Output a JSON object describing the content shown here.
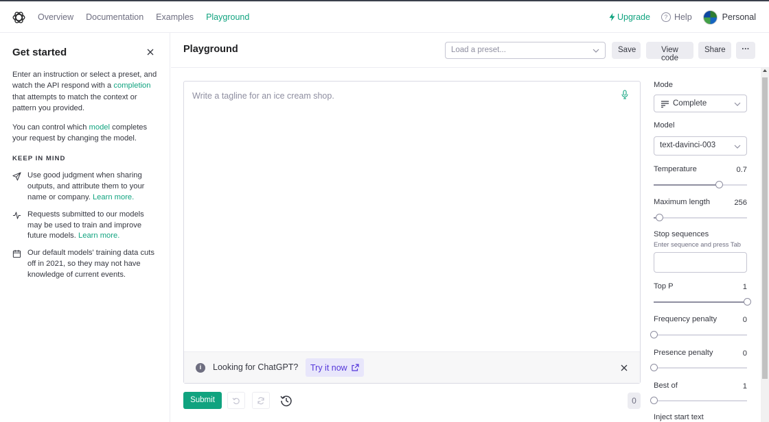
{
  "nav": {
    "links": [
      "Overview",
      "Documentation",
      "Examples",
      "Playground"
    ],
    "active": "Playground",
    "upgrade": "Upgrade",
    "help": "Help",
    "account": "Personal"
  },
  "sidebar": {
    "title": "Get started",
    "intro_before": "Enter an instruction or select a preset, and watch the API respond with a ",
    "intro_link": "completion",
    "intro_after": " that attempts to match the context or pattern you provided.",
    "control_before": "You can control which ",
    "control_link": "model",
    "control_after": " completes your request by changing the model.",
    "keep_heading": "KEEP IN MIND",
    "tips": [
      {
        "icon": "send-icon",
        "text": "Use good judgment when sharing outputs, and attribute them to your name or company.",
        "link": "Learn more."
      },
      {
        "icon": "activity-icon",
        "text": "Requests submitted to our models may be used to train and improve future models.",
        "link": "Learn more."
      },
      {
        "icon": "calendar-icon",
        "text": "Our default models' training data cuts off in 2021, so they may not have knowledge of current events.",
        "link": ""
      }
    ]
  },
  "header": {
    "title": "Playground",
    "preset_placeholder": "Load a preset...",
    "save": "Save",
    "view_code": "View code",
    "share": "Share",
    "more": "···"
  },
  "editor": {
    "placeholder": "Write a tagline for an ice cream shop.",
    "chat_prompt": "Looking for ChatGPT?",
    "try_it": "Try it now"
  },
  "footer": {
    "submit": "Submit",
    "token_count": "0"
  },
  "settings": {
    "mode_label": "Mode",
    "mode_value": "Complete",
    "model_label": "Model",
    "model_value": "text-davinci-003",
    "temperature_label": "Temperature",
    "temperature_value": "0.7",
    "temperature_fraction": 0.7,
    "max_length_label": "Maximum length",
    "max_length_value": "256",
    "max_length_fraction": 0.06,
    "stop_label": "Stop sequences",
    "stop_hint": "Enter sequence and press Tab",
    "top_p_label": "Top P",
    "top_p_value": "1",
    "top_p_fraction": 1.0,
    "frequency_label": "Frequency penalty",
    "frequency_value": "0",
    "frequency_fraction": 0.0,
    "presence_label": "Presence penalty",
    "presence_value": "0",
    "presence_fraction": 0.0,
    "best_of_label": "Best of",
    "best_of_value": "1",
    "best_of_fraction": 0.0,
    "inject_label": "Inject start text"
  },
  "colors": {
    "accent": "#10a37f",
    "link_purple": "#5436da"
  }
}
